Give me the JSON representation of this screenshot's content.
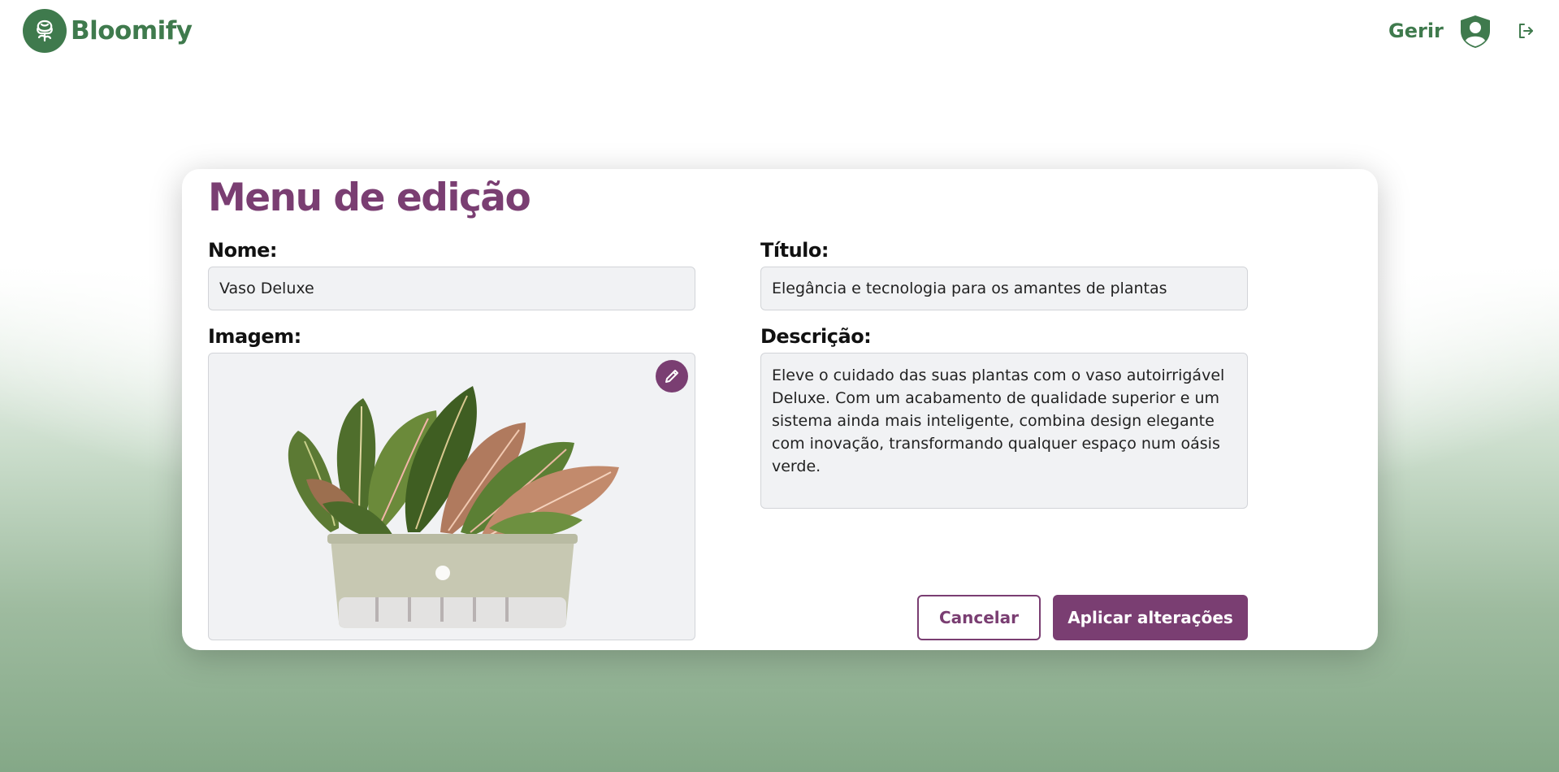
{
  "brand": {
    "name": "Bloomify",
    "logo_icon": "rose-icon",
    "color": "#3f7a4d"
  },
  "nav": {
    "manage_label": "Gerir",
    "profile_icon": "user-shield-icon",
    "logout_icon": "logout-icon"
  },
  "editor": {
    "title": "Menu de edição",
    "name": {
      "label": "Nome:",
      "value": "Vaso Deluxe"
    },
    "headline": {
      "label": "Título:",
      "value": "Elegância e tecnologia para os amantes de plantas"
    },
    "image": {
      "label": "Imagem:",
      "alt": "Vaso Deluxe com plantas",
      "edit_icon": "pencil-icon"
    },
    "description": {
      "label": "Descrição:",
      "value": "Eleve o cuidado das suas plantas com o vaso autoirrigável Deluxe. Com um acabamento de qualidade superior e um sistema ainda mais inteligente, combina design elegante com inovação, transformando qualquer espaço num oásis verde."
    },
    "cancel_label": "Cancelar",
    "apply_label": "Aplicar alterações"
  },
  "colors": {
    "accent": "#7a3e72",
    "brand_green": "#3f7a4d"
  }
}
